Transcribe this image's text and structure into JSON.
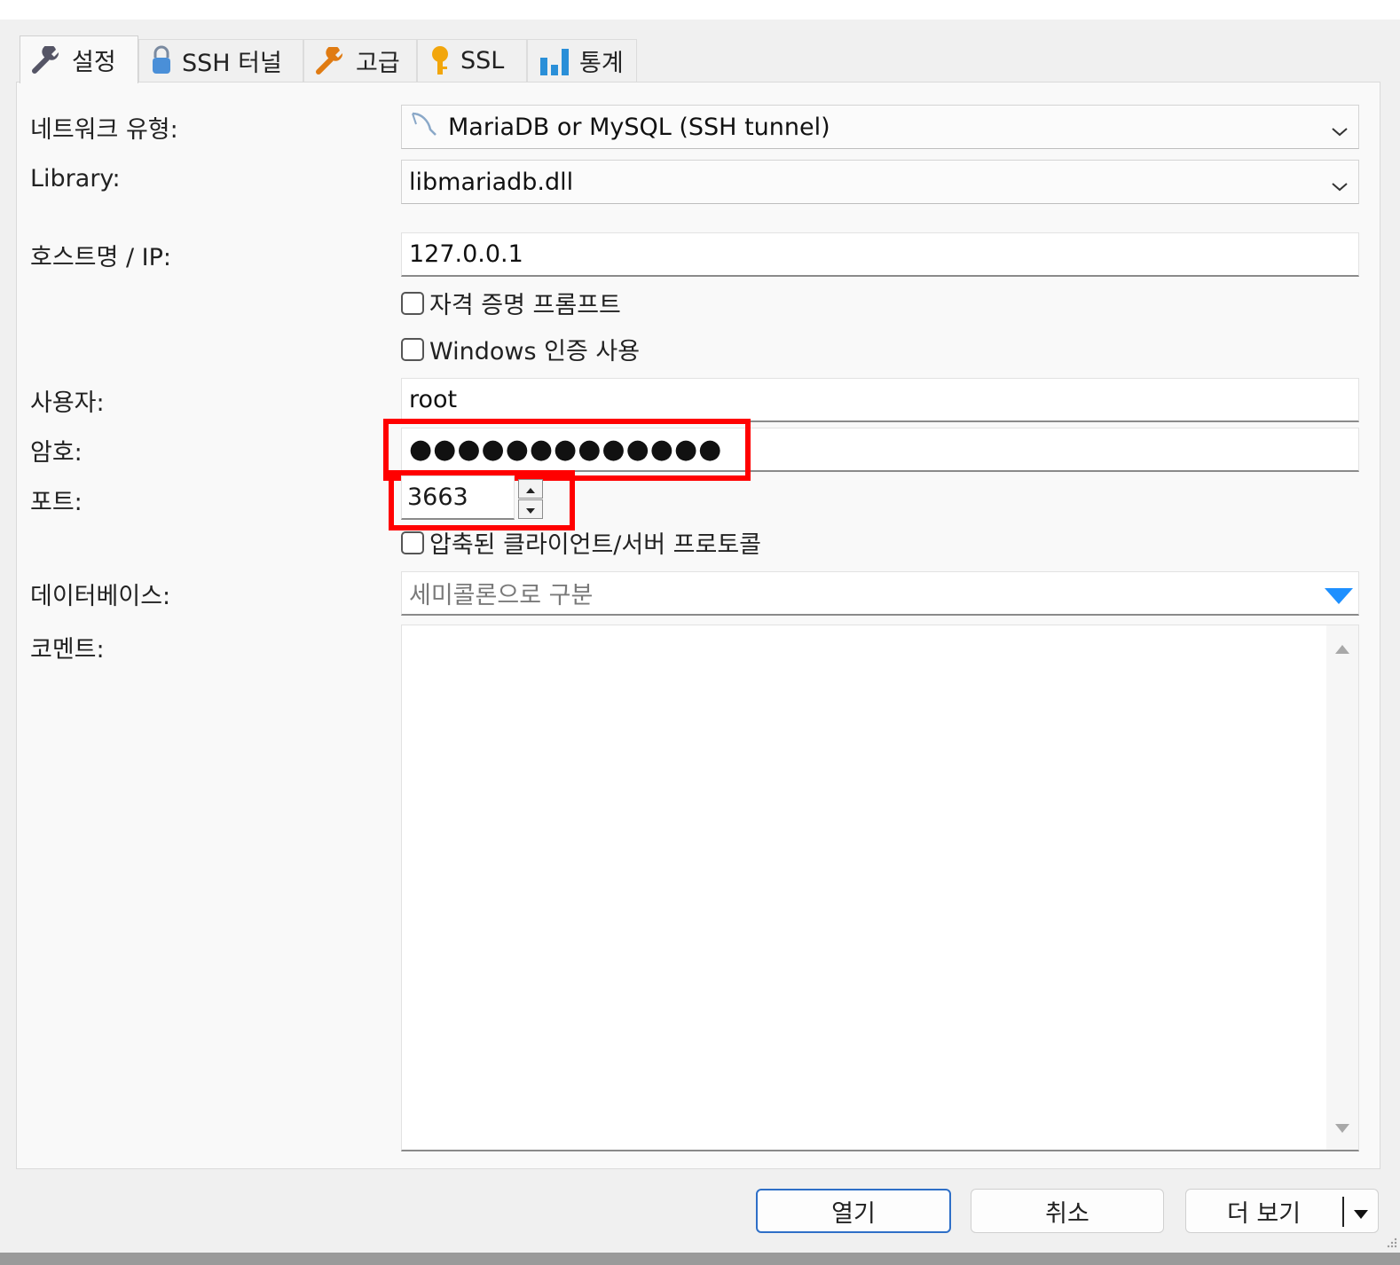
{
  "tabs": [
    {
      "label": "설정",
      "icon": "wrench-icon",
      "active": true
    },
    {
      "label": "SSH 터널",
      "icon": "lock-icon",
      "active": false
    },
    {
      "label": "고급",
      "icon": "wrench-icon",
      "active": false
    },
    {
      "label": "SSL",
      "icon": "key-icon",
      "active": false
    },
    {
      "label": "통계",
      "icon": "bar-chart-icon",
      "active": false
    }
  ],
  "form": {
    "network_type": {
      "label": "네트워크 유형:",
      "value": "MariaDB or MySQL (SSH tunnel)",
      "icon": "dolphin-icon"
    },
    "library": {
      "label": "Library:",
      "value": "libmariadb.dll"
    },
    "hostname": {
      "label": "호스트명 / IP:",
      "value": "127.0.0.1"
    },
    "credential_prompt": {
      "label": "자격 증명 프롬프트",
      "checked": false
    },
    "windows_auth": {
      "label": "Windows 인증 사용",
      "checked": false
    },
    "user": {
      "label": "사용자:",
      "value": "root"
    },
    "password": {
      "label": "암호:",
      "value": "●●●●●●●●●●●●●"
    },
    "port": {
      "label": "포트:",
      "value": "3663"
    },
    "compressed_protocol": {
      "label": "압축된 클라이언트/서버 프로토콜",
      "checked": false
    },
    "databases": {
      "label": "데이터베이스:",
      "placeholder": "세미콜론으로 구분"
    },
    "comment": {
      "label": "코멘트:",
      "value": ""
    }
  },
  "buttons": {
    "open": "열기",
    "cancel": "취소",
    "more": "더 보기"
  },
  "colors": {
    "highlight": "#ff0000",
    "primary_border": "#2e6fc7",
    "dropdown_arrow": "#1e90ff"
  }
}
